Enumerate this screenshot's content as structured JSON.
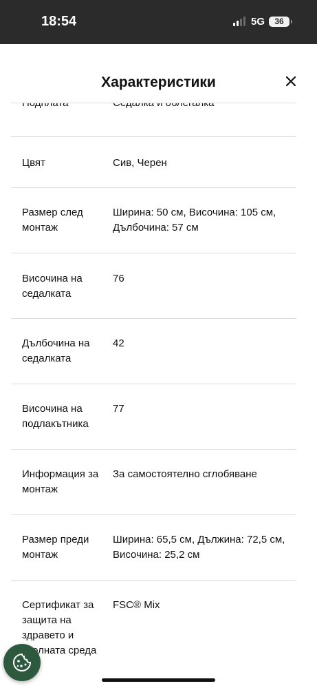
{
  "status_bar": {
    "time": "18:54",
    "network": "5G",
    "battery": "36"
  },
  "sheet": {
    "title": "Характеристики",
    "close_icon": "close-icon"
  },
  "rows": [
    {
      "label": "Подплата",
      "value": "Седалка и облегалка"
    },
    {
      "label": "Цвят",
      "value": "Сив, Черен"
    },
    {
      "label": "Размер след монтаж",
      "value": "Ширина: 50 см, Височина: 105 см, Дълбочина: 57 см"
    },
    {
      "label": "Височина на седалката",
      "value": "76"
    },
    {
      "label": "Дълбочина на седалката",
      "value": "42"
    },
    {
      "label": "Височина на подлакътника",
      "value": "77"
    },
    {
      "label": "Информация за монтаж",
      "value": "За самостоятелно сглобяване"
    },
    {
      "label": "Размер преди монтаж",
      "value": "Ширина: 65,5 см, Дължина: 72,5 см, Височина: 25,2 см"
    },
    {
      "label": "Сертификат за защита на здравето и околната среда",
      "value": "FSC® Mix"
    }
  ],
  "cookie_button": {
    "icon": "cookie-icon",
    "color": "#2d5a3e"
  }
}
